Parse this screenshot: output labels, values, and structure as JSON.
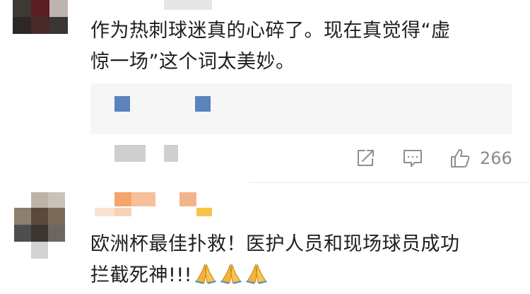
{
  "comments": [
    {
      "text_line1": "作为热刺球迷真的心碎了。现在真觉得“虚",
      "text_line2": "惊一场”这个词太美妙。",
      "likes": "266"
    },
    {
      "text_line1": "欧洲杯最佳扑救！医护人员和现场球员成功",
      "text_line2": "拦截死神!!!",
      "emoji": [
        "folded-hands",
        "folded-hands",
        "folded-hands"
      ]
    }
  ],
  "colors": {
    "text": "#1e1e1e",
    "muted": "#8a8a8a",
    "quote_bg": "#f6f6f6",
    "link_block": "#5b83bd",
    "username_orange": "#f39a5a"
  },
  "icons": [
    "share-icon",
    "comment-icon",
    "like-icon"
  ]
}
